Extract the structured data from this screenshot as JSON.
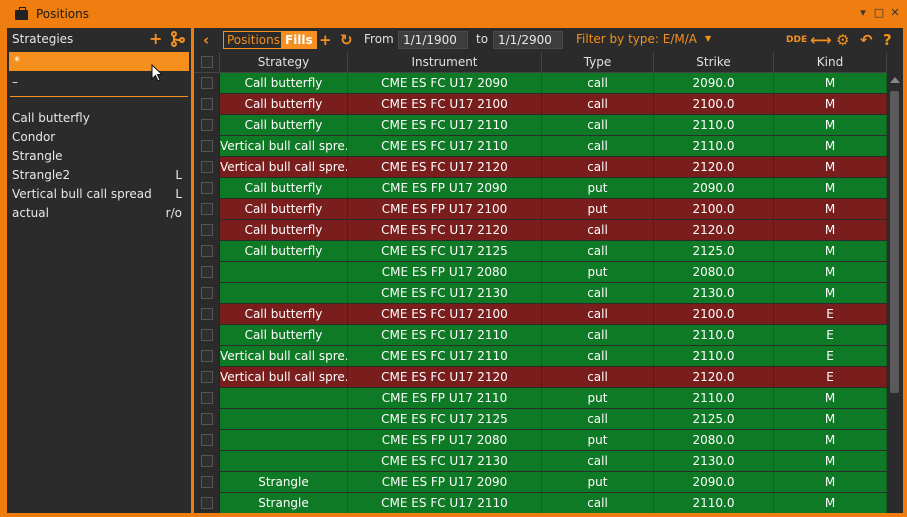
{
  "window": {
    "title": "Positions",
    "controls": [
      "▾",
      "□",
      "✕"
    ]
  },
  "strategies": {
    "header": "Strategies",
    "items": [
      {
        "label": "*",
        "flag": "",
        "selected": true
      },
      {
        "label": "–",
        "flag": "",
        "selected": false
      },
      {
        "label": "Call butterfly",
        "flag": ""
      },
      {
        "label": "Condor",
        "flag": ""
      },
      {
        "label": "Strangle",
        "flag": ""
      },
      {
        "label": "Strangle2",
        "flag": "L"
      },
      {
        "label": "Vertical bull call spread",
        "flag": "L"
      },
      {
        "label": "actual",
        "flag": "r/o"
      }
    ]
  },
  "toolbar": {
    "positions_label": "Positions",
    "fills_label": "Fills",
    "from_label": "From",
    "from_value": "1/1/1900",
    "to_label": "to",
    "to_value": "1/1/2900",
    "filter_label": "Filter by type: E/M/A",
    "dde_label": "DDE"
  },
  "table": {
    "columns": [
      "Strategy",
      "Instrument",
      "Type",
      "Strike",
      "Kind"
    ],
    "rows": [
      {
        "color": "green",
        "strategy": "Call butterfly",
        "instrument": "CME ES FC U17 2090",
        "type": "call",
        "strike": "2090.0",
        "kind": "M"
      },
      {
        "color": "red",
        "strategy": "Call butterfly",
        "instrument": "CME ES FC U17 2100",
        "type": "call",
        "strike": "2100.0",
        "kind": "M"
      },
      {
        "color": "green",
        "strategy": "Call butterfly",
        "instrument": "CME ES FC U17 2110",
        "type": "call",
        "strike": "2110.0",
        "kind": "M"
      },
      {
        "color": "green",
        "strategy": "Vertical bull call spre...",
        "instrument": "CME ES FC U17 2110",
        "type": "call",
        "strike": "2110.0",
        "kind": "M"
      },
      {
        "color": "red",
        "strategy": "Vertical bull call spre...",
        "instrument": "CME ES FC U17 2120",
        "type": "call",
        "strike": "2120.0",
        "kind": "M"
      },
      {
        "color": "green",
        "strategy": "Call butterfly",
        "instrument": "CME ES FP U17 2090",
        "type": "put",
        "strike": "2090.0",
        "kind": "M"
      },
      {
        "color": "red",
        "strategy": "Call butterfly",
        "instrument": "CME ES FP U17 2100",
        "type": "put",
        "strike": "2100.0",
        "kind": "M"
      },
      {
        "color": "red",
        "strategy": "Call butterfly",
        "instrument": "CME ES FC U17 2120",
        "type": "call",
        "strike": "2120.0",
        "kind": "M"
      },
      {
        "color": "green",
        "strategy": "Call butterfly",
        "instrument": "CME ES FC U17 2125",
        "type": "call",
        "strike": "2125.0",
        "kind": "M"
      },
      {
        "color": "green",
        "strategy": "",
        "instrument": "CME ES FP U17 2080",
        "type": "put",
        "strike": "2080.0",
        "kind": "M"
      },
      {
        "color": "green",
        "strategy": "",
        "instrument": "CME ES FC U17 2130",
        "type": "call",
        "strike": "2130.0",
        "kind": "M"
      },
      {
        "color": "red",
        "strategy": "Call butterfly",
        "instrument": "CME ES FC U17 2100",
        "type": "call",
        "strike": "2100.0",
        "kind": "E"
      },
      {
        "color": "green",
        "strategy": "Call butterfly",
        "instrument": "CME ES FC U17 2110",
        "type": "call",
        "strike": "2110.0",
        "kind": "E"
      },
      {
        "color": "green",
        "strategy": "Vertical bull call spre...",
        "instrument": "CME ES FC U17 2110",
        "type": "call",
        "strike": "2110.0",
        "kind": "E"
      },
      {
        "color": "red",
        "strategy": "Vertical bull call spre...",
        "instrument": "CME ES FC U17 2120",
        "type": "call",
        "strike": "2120.0",
        "kind": "E"
      },
      {
        "color": "green",
        "strategy": "",
        "instrument": "CME ES FP U17 2110",
        "type": "put",
        "strike": "2110.0",
        "kind": "M"
      },
      {
        "color": "green",
        "strategy": "",
        "instrument": "CME ES FC U17 2125",
        "type": "call",
        "strike": "2125.0",
        "kind": "M"
      },
      {
        "color": "green",
        "strategy": "",
        "instrument": "CME ES FP U17 2080",
        "type": "put",
        "strike": "2080.0",
        "kind": "M"
      },
      {
        "color": "green",
        "strategy": "",
        "instrument": "CME ES FC U17 2130",
        "type": "call",
        "strike": "2130.0",
        "kind": "M"
      },
      {
        "color": "green",
        "strategy": "Strangle",
        "instrument": "CME ES FP U17 2090",
        "type": "put",
        "strike": "2090.0",
        "kind": "M"
      },
      {
        "color": "green",
        "strategy": "Strangle",
        "instrument": "CME ES FC U17 2110",
        "type": "call",
        "strike": "2110.0",
        "kind": "M"
      }
    ]
  },
  "colors": {
    "accent": "#f5901e",
    "row_green": "#0f7a25",
    "row_red": "#7a1d1d",
    "panel_bg": "#2b2b2b"
  }
}
